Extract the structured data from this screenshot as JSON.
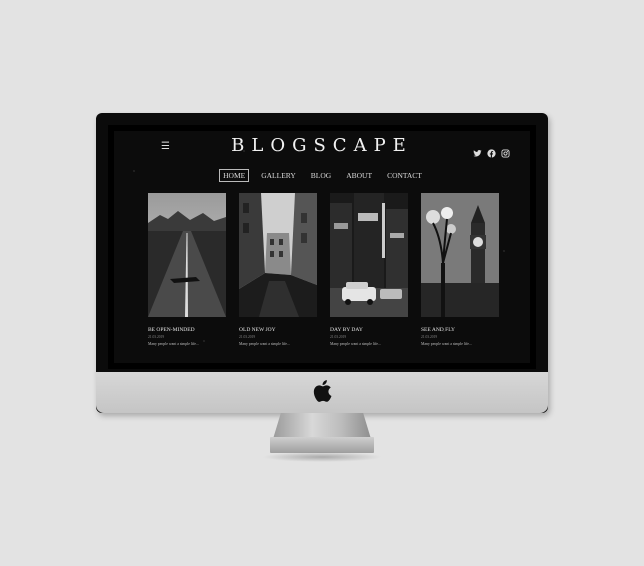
{
  "site": {
    "brand": "BLOGSCAPE",
    "menu_icon": "hamburger-icon",
    "social_icons": [
      "twitter-icon",
      "facebook-icon",
      "instagram-icon"
    ],
    "nav": [
      {
        "label": "HOME",
        "active": true
      },
      {
        "label": "GALLERY",
        "active": false
      },
      {
        "label": "BLOG",
        "active": false
      },
      {
        "label": "ABOUT",
        "active": false
      },
      {
        "label": "CONTACT",
        "active": false
      }
    ],
    "posts": [
      {
        "title": "BE OPEN-MINDED",
        "date": "21.03.2019",
        "excerpt": "Many people want a simple life..."
      },
      {
        "title": "OLD NEW JOY",
        "date": "21.03.2019",
        "excerpt": "Many people want a simple life..."
      },
      {
        "title": "DAY BY DAY",
        "date": "21.03.2019",
        "excerpt": "Many people want a simple life..."
      },
      {
        "title": "SEE AND FLY",
        "date": "21.03.2019",
        "excerpt": "Many people want a simple life..."
      }
    ]
  },
  "colors": {
    "background": "#e3e3e3",
    "screen": "#0c0c0c",
    "text": "#f2f2f2"
  }
}
